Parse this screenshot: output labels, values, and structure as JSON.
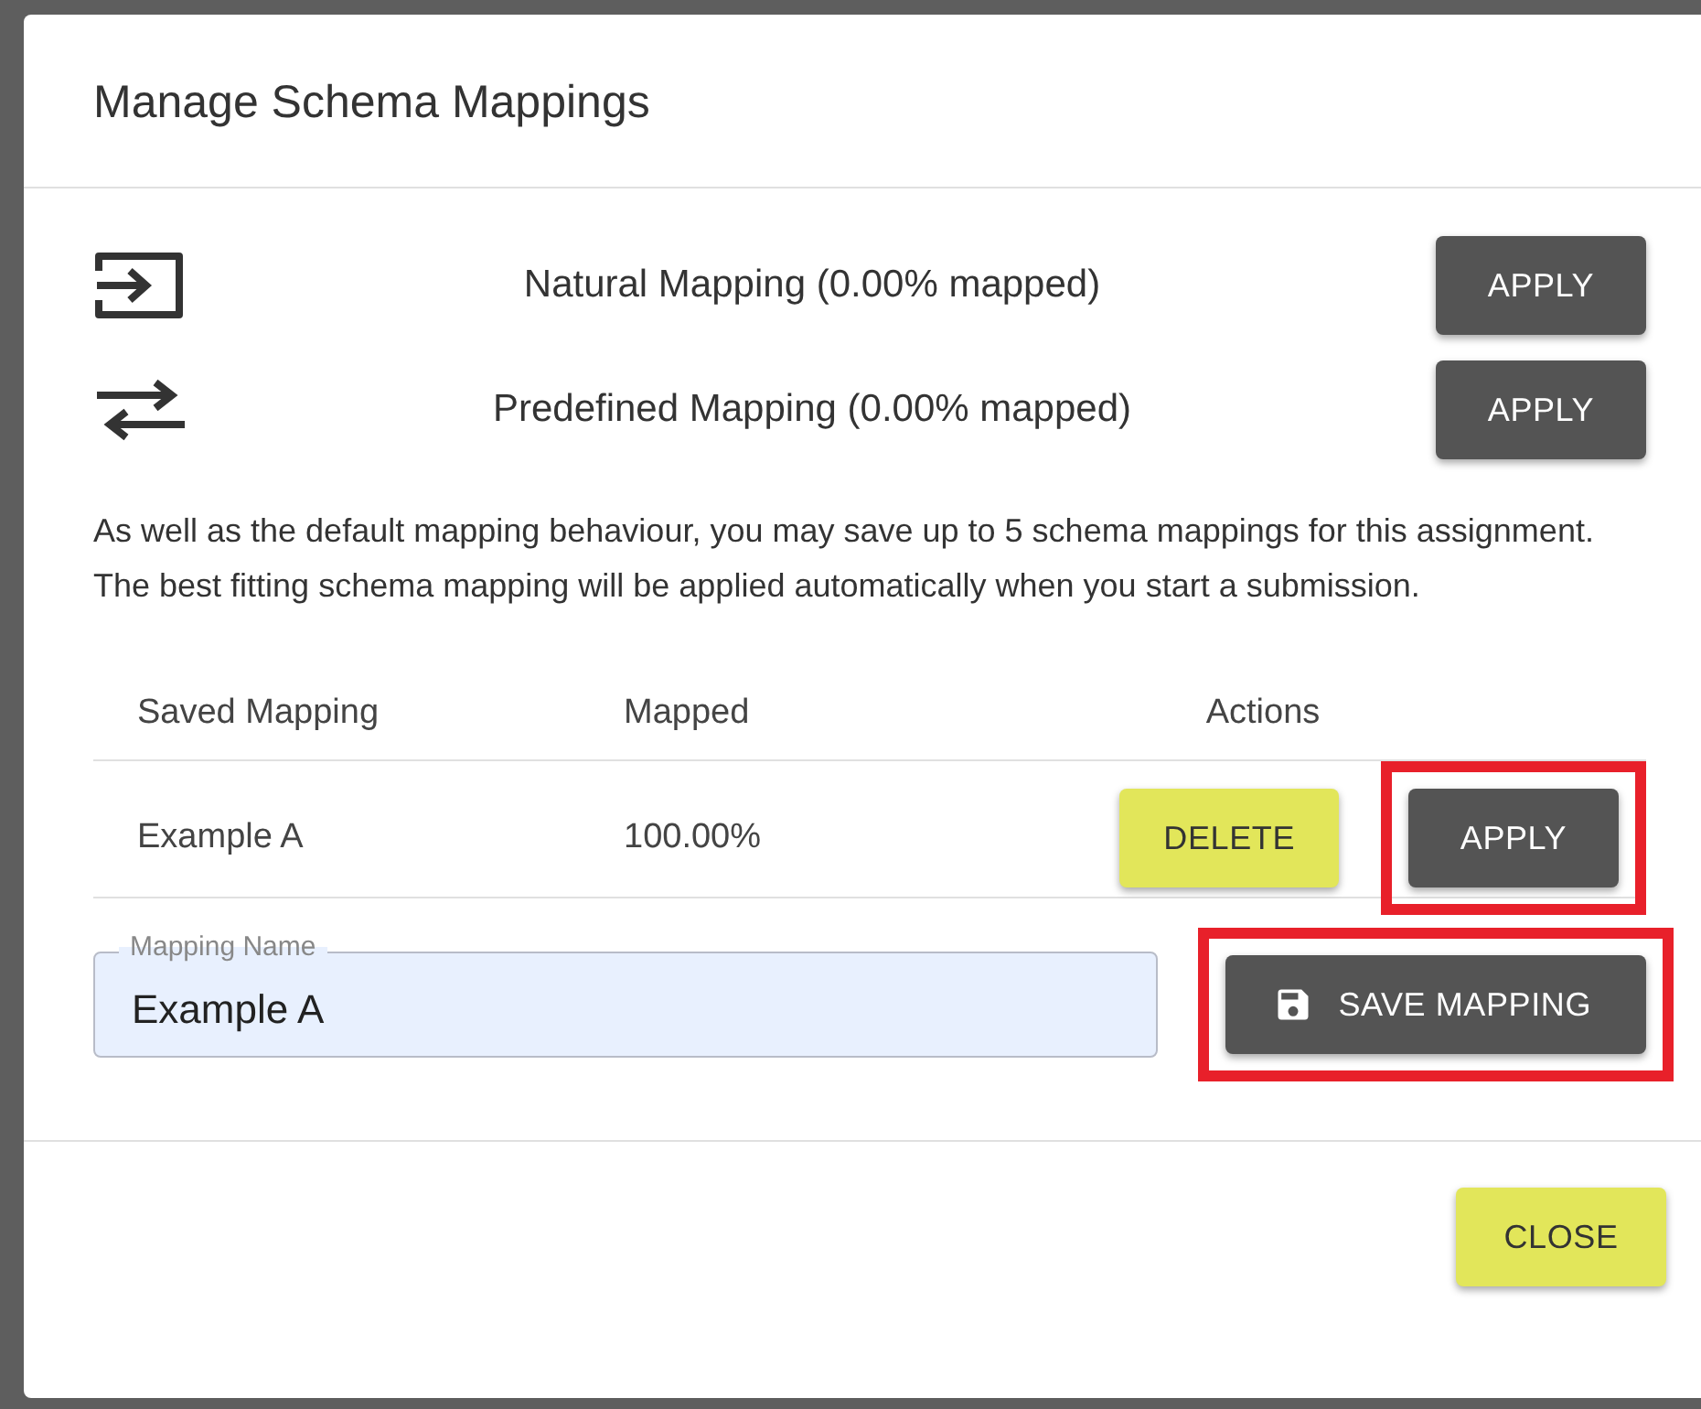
{
  "dialog": {
    "title": "Manage Schema Mappings"
  },
  "mapping_options": [
    {
      "kind": "natural",
      "label": "Natural Mapping (0.00% mapped)",
      "button": "APPLY"
    },
    {
      "kind": "predefined",
      "label": "Predefined Mapping (0.00% mapped)",
      "button": "APPLY"
    }
  ],
  "description": "As well as the default mapping behaviour, you may save up to 5 schema mappings for this assignment. The best fitting schema mapping will be applied automatically when you start a submission.",
  "table": {
    "columns": [
      "Saved Mapping",
      "Mapped",
      "Actions"
    ],
    "rows": [
      {
        "name": "Example A",
        "mapped": "100.00%",
        "actions": [
          {
            "kind": "delete",
            "label": "DELETE",
            "highlighted": false
          },
          {
            "kind": "apply",
            "label": "APPLY",
            "highlighted": true
          }
        ]
      }
    ]
  },
  "name_field": {
    "label": "Mapping Name",
    "value": "Example A"
  },
  "save_button": {
    "label": "SAVE MAPPING",
    "highlighted": true
  },
  "footer": {
    "buttons": [
      {
        "label": "CLOSE"
      }
    ]
  }
}
